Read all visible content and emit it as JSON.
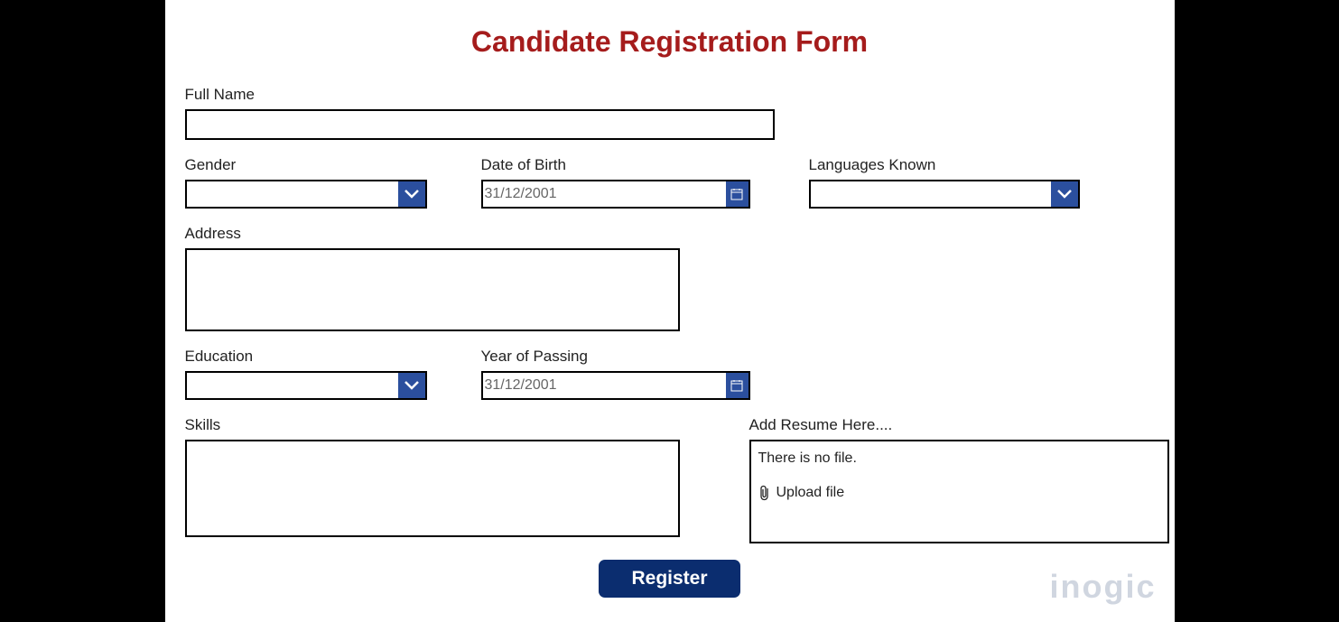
{
  "title": "Candidate Registration Form",
  "labels": {
    "fullName": "Full Name",
    "gender": "Gender",
    "dob": "Date of Birth",
    "languages": "Languages Known",
    "address": "Address",
    "education": "Education",
    "yop": "Year of Passing",
    "skills": "Skills",
    "resume": "Add Resume Here...."
  },
  "values": {
    "fullName": "",
    "gender": "",
    "dob": "31/12/2001",
    "languages": "",
    "address": "",
    "education": "",
    "yop": "31/12/2001",
    "skills": ""
  },
  "resume": {
    "status": "There is no file.",
    "uploadLabel": "Upload file"
  },
  "buttons": {
    "register": "Register"
  },
  "watermark": "inogic"
}
